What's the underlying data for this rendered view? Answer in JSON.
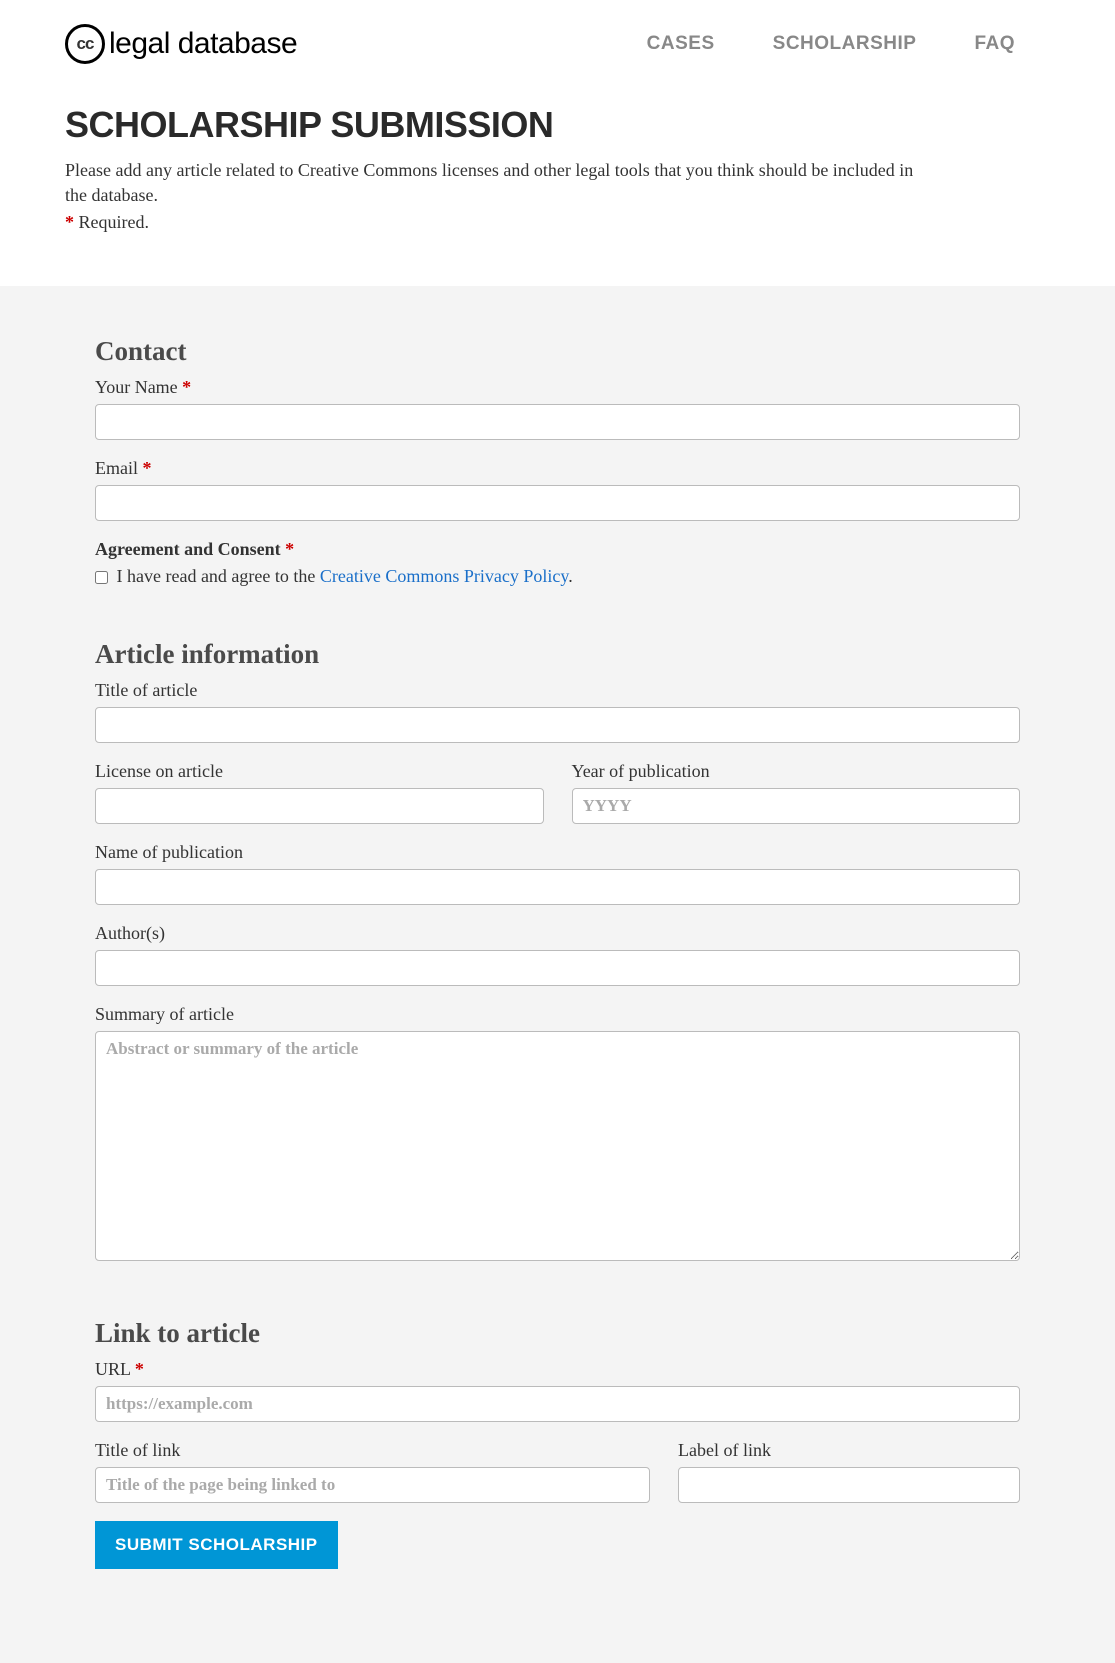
{
  "logo": {
    "cc": "cc",
    "text": "legal database"
  },
  "nav": {
    "cases": "CASES",
    "scholarship": "SCHOLARSHIP",
    "faq": "FAQ"
  },
  "page": {
    "title": "SCHOLARSHIP SUBMISSION",
    "intro": "Please add any article related to Creative Commons licenses and other legal tools that you think should be included in the database.",
    "required_marker": "*",
    "required_text": " Required."
  },
  "sections": {
    "contact": "Contact",
    "article": "Article information",
    "link": "Link to article"
  },
  "labels": {
    "name": "Your Name ",
    "email": "Email ",
    "agreement": "Agreement and Consent ",
    "consent_prefix": " I have read and agree to the ",
    "consent_link": "Creative Commons Privacy Policy",
    "consent_suffix": ".",
    "title_article": "Title of article",
    "license": "License on article",
    "year": "Year of publication",
    "publication": "Name of publication",
    "authors": "Author(s)",
    "summary": "Summary of article",
    "url": "URL ",
    "link_title": "Title of link",
    "link_label": "Label of link"
  },
  "placeholders": {
    "year": "YYYY",
    "summary": "Abstract or summary of the article",
    "url": "https://example.com",
    "link_title": "Title of the page being linked to"
  },
  "submit": "SUBMIT SCHOLARSHIP"
}
